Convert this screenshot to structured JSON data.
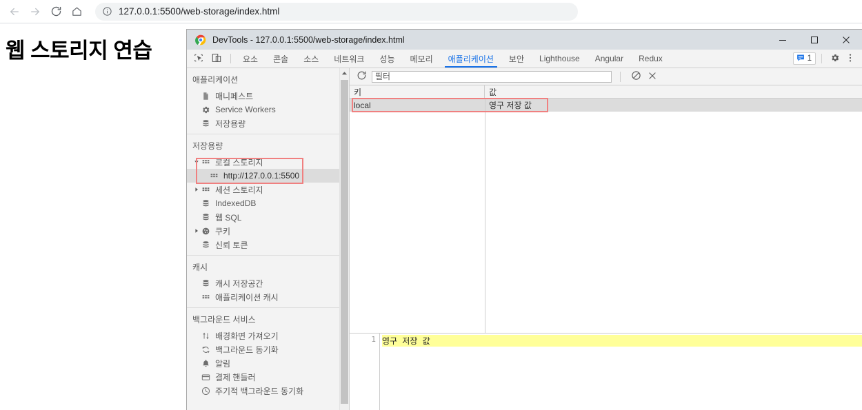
{
  "browser": {
    "back_icon": "arrow-left-icon",
    "forward_icon": "arrow-right-icon",
    "reload_icon": "reload-icon",
    "home_icon": "home-icon",
    "info_icon": "info-circle-icon",
    "url": "127.0.0.1:5500/web-storage/index.html"
  },
  "page": {
    "heading": "웹 스토리지 연습"
  },
  "devtools": {
    "window_title": "DevTools - 127.0.0.1:5500/web-storage/index.html",
    "window_controls": {
      "minimize": "minimize-icon",
      "maximize": "maximize-icon",
      "close": "close-icon"
    },
    "toolbar_icons": {
      "inspect": "inspect-element-icon",
      "device": "device-toolbar-icon"
    },
    "tabs": [
      {
        "label": "요소",
        "active": false
      },
      {
        "label": "콘솔",
        "active": false
      },
      {
        "label": "소스",
        "active": false
      },
      {
        "label": "네트워크",
        "active": false
      },
      {
        "label": "성능",
        "active": false
      },
      {
        "label": "메모리",
        "active": false
      },
      {
        "label": "애플리케이션",
        "active": true
      },
      {
        "label": "보안",
        "active": false
      },
      {
        "label": "Lighthouse",
        "active": false
      },
      {
        "label": "Angular",
        "active": false
      },
      {
        "label": "Redux",
        "active": false
      }
    ],
    "message_badge_count": "1",
    "settings_icon": "gear-icon",
    "more_icon": "kebab-menu-icon",
    "accent_color": "#1a73e8"
  },
  "sidebar": {
    "sections": [
      {
        "header": "애플리케이션",
        "items": [
          {
            "label": "매니페스트",
            "icon": "manifest-document-icon",
            "arrow": "none",
            "indent": 0,
            "selected": false
          },
          {
            "label": "Service Workers",
            "icon": "gear-icon",
            "arrow": "none",
            "indent": 0,
            "selected": false
          },
          {
            "label": "저장용량",
            "icon": "database-icon",
            "arrow": "none",
            "indent": 0,
            "selected": false
          }
        ]
      },
      {
        "header": "저장용량",
        "items": [
          {
            "label": "로컬 스토리지",
            "icon": "grid-storage-icon",
            "arrow": "down",
            "indent": 0,
            "selected": false
          },
          {
            "label": "http://127.0.0.1:5500",
            "icon": "grid-storage-icon",
            "arrow": "none",
            "indent": 1,
            "selected": true
          },
          {
            "label": "세션 스토리지",
            "icon": "grid-storage-icon",
            "arrow": "right",
            "indent": 0,
            "selected": false
          },
          {
            "label": "IndexedDB",
            "icon": "database-icon",
            "arrow": "none",
            "indent": 0,
            "selected": false
          },
          {
            "label": "웹 SQL",
            "icon": "database-icon",
            "arrow": "none",
            "indent": 0,
            "selected": false
          },
          {
            "label": "쿠키",
            "icon": "cookie-icon",
            "arrow": "right",
            "indent": 0,
            "selected": false
          },
          {
            "label": "신뢰 토큰",
            "icon": "database-icon",
            "arrow": "none",
            "indent": 0,
            "selected": false
          }
        ]
      },
      {
        "header": "캐시",
        "items": [
          {
            "label": "캐시 저장공간",
            "icon": "database-icon",
            "arrow": "none",
            "indent": 0,
            "selected": false
          },
          {
            "label": "애플리케이션 캐시",
            "icon": "grid-storage-icon",
            "arrow": "none",
            "indent": 0,
            "selected": false
          }
        ]
      },
      {
        "header": "백그라운드 서비스",
        "items": [
          {
            "label": "배경화면 가져오기",
            "icon": "updown-arrows-icon",
            "arrow": "none",
            "indent": 0,
            "selected": false
          },
          {
            "label": "백그라운드 동기화",
            "icon": "sync-icon",
            "arrow": "none",
            "indent": 0,
            "selected": false
          },
          {
            "label": "알림",
            "icon": "bell-icon",
            "arrow": "none",
            "indent": 0,
            "selected": false
          },
          {
            "label": "결제 핸들러",
            "icon": "credit-card-icon",
            "arrow": "none",
            "indent": 0,
            "selected": false
          },
          {
            "label": "주기적 백그라운드 동기화",
            "icon": "clock-icon",
            "arrow": "none",
            "indent": 0,
            "selected": false
          }
        ]
      }
    ]
  },
  "storage_panel": {
    "refresh_icon": "refresh-icon",
    "filter_placeholder": "필터",
    "clear_all_icon": "no-entry-clear-icon",
    "delete_selected_icon": "close-x-icon",
    "columns": [
      "키",
      "값"
    ],
    "rows": [
      {
        "key": "local",
        "value": "영구 저장 값",
        "selected": true
      }
    ],
    "preview": {
      "line_number": "1",
      "content": "영구 저장 값"
    }
  },
  "annotations": {
    "highlight_color": "#f08080"
  }
}
